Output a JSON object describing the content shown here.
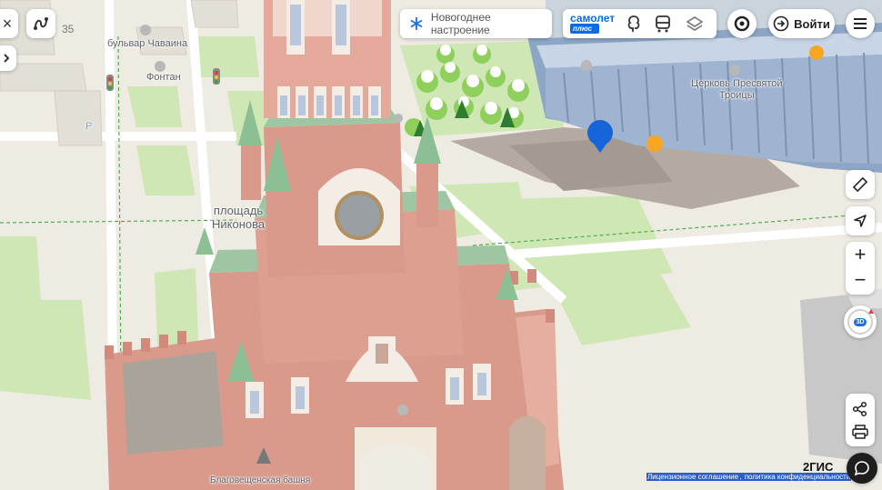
{
  "top_left": {
    "close_label": "×",
    "route_badge": "35"
  },
  "promo": {
    "label": "Новогоднее настроение"
  },
  "samolet": {
    "top": "самолет",
    "bottom": "плюс"
  },
  "login": {
    "label": "Войти"
  },
  "map_labels": {
    "boulevard": "бульвар Чаваина",
    "fountain": "Фонтан",
    "parking": "P",
    "square_line1": "площадь",
    "square_line2": "Никонова",
    "church_line1": "Церковь Пресвятой",
    "church_line2": "Троицы",
    "tower": "Благовещенская башня"
  },
  "zoom": {
    "plus": "+",
    "minus": "−"
  },
  "compass": {
    "mode": "3D"
  },
  "footer": {
    "brand": "2ГИС",
    "license": "Лицензионное соглашение",
    "privacy": "политика конфиденциальности"
  },
  "colors": {
    "accent_blue": "#1a6fe0",
    "map_pin": "#1565d8",
    "samolet_blue": "#0a6be6"
  }
}
